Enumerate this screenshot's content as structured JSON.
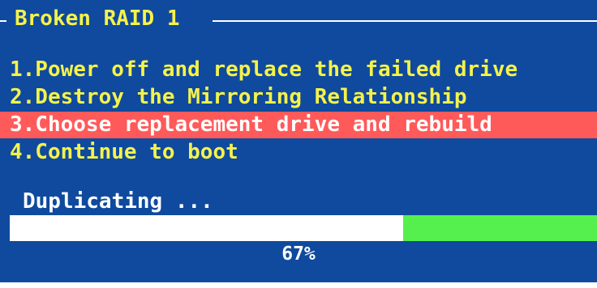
{
  "title": "Broken RAID 1",
  "menu": {
    "items": [
      {
        "label": "1.Power off and replace the failed drive",
        "selected": false
      },
      {
        "label": "2.Destroy the Mirroring Relationship",
        "selected": false
      },
      {
        "label": "3.Choose replacement drive and rebuild",
        "selected": true
      },
      {
        "label": "4.Continue to boot",
        "selected": false
      }
    ]
  },
  "status": {
    "text": "Duplicating ...",
    "progress_percent_label": "67%",
    "progress_fill_fraction": 0.33
  },
  "colors": {
    "background": "#0F4A9E",
    "text_yellow": "#F5F24A",
    "selection_red": "#FF5A5A",
    "progress_track": "#FFFFFF",
    "progress_fill": "#55F04E"
  }
}
